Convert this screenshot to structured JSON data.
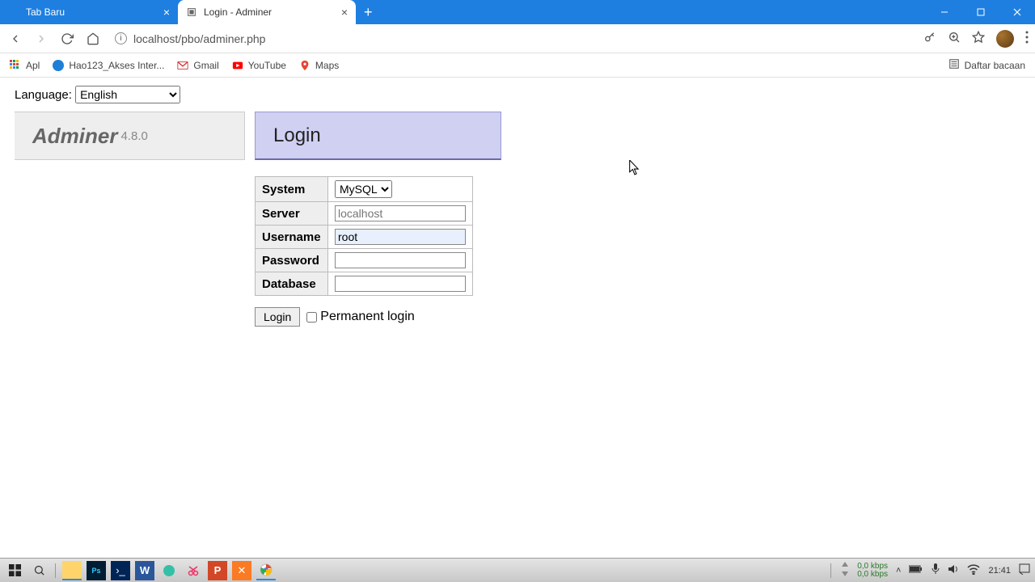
{
  "window": {
    "tabs": [
      {
        "title": "Tab Baru",
        "active": false
      },
      {
        "title": "Login - Adminer",
        "active": true
      }
    ],
    "url": "localhost/pbo/adminer.php"
  },
  "bookmarks": {
    "items": [
      "Apl",
      "Hao123_Akses Inter...",
      "Gmail",
      "YouTube",
      "Maps"
    ],
    "reading_list": "Daftar bacaan"
  },
  "adminer": {
    "language_label": "Language:",
    "language_value": "English",
    "brand": "Adminer",
    "version": "4.8.0",
    "login_heading": "Login",
    "fields": {
      "system": {
        "label": "System",
        "value": "MySQL"
      },
      "server": {
        "label": "Server",
        "value": "",
        "placeholder": "localhost"
      },
      "username": {
        "label": "Username",
        "value": "root"
      },
      "password": {
        "label": "Password",
        "value": ""
      },
      "database": {
        "label": "Database",
        "value": ""
      }
    },
    "login_button": "Login",
    "permanent_label": "Permanent login"
  },
  "taskbar": {
    "net_down": "0,0 kbps",
    "net_up": "0,0 kbps",
    "time": "21:41"
  }
}
